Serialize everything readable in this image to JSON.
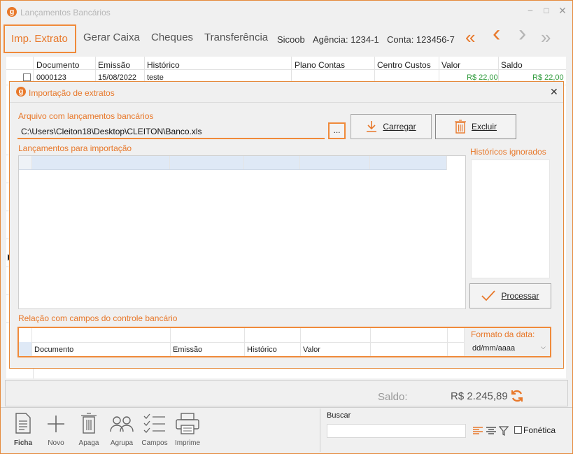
{
  "window": {
    "title": "Lançamentos Bancários",
    "app_icon_glyph": "g"
  },
  "tabs": [
    {
      "label": "Imp. Extrato",
      "active": true
    },
    {
      "label": "Gerar Caixa"
    },
    {
      "label": "Cheques"
    },
    {
      "label": "Transferência"
    }
  ],
  "account": {
    "bank": "Sicoob",
    "agency": "Agência: 1234-1",
    "account": "Conta: 123456-7"
  },
  "nav": {
    "first": "«",
    "prev": "‹",
    "next": "›",
    "last": "»"
  },
  "grid": {
    "columns": [
      "Documento",
      "Emissão",
      "Histórico",
      "Plano Contas",
      "Centro Custos",
      "Valor",
      "Saldo"
    ],
    "rows": [
      {
        "documento": "0000123",
        "emissao": "15/08/2022",
        "historico": "teste",
        "plano": "",
        "centro": "",
        "valor": "R$ 22,00",
        "saldo": "R$ 22,00"
      }
    ]
  },
  "dialog": {
    "title": "Importação de extratos",
    "icon_glyph": "g",
    "file_label": "Arquivo com lançamentos bancários",
    "file_path": "C:\\Users\\Cleiton18\\Desktop\\CLEITON\\Banco.xls",
    "browse_label": "...",
    "load_label": "Carregar",
    "delete_label": "Excluir",
    "entries_label": "Lançamentos para importação",
    "ignored_label": "Históricos ignorados",
    "process_label": "Processar",
    "mapping_label": "Relação com campos do controle bancário",
    "mapping_columns": [
      "Documento",
      "Emissão",
      "Histórico",
      "Valor",
      ""
    ],
    "date_format_label": "Formato da data:",
    "date_format_value": "dd/mm/aaaa"
  },
  "balance": {
    "label": "Saldo:",
    "value": "R$ 2.245,89"
  },
  "toolbar": [
    {
      "label": "Ficha",
      "icon": "document-icon"
    },
    {
      "label": "Novo",
      "icon": "plus-icon"
    },
    {
      "label": "Apaga",
      "icon": "trash-icon"
    },
    {
      "label": "Agrupa",
      "icon": "group-icon"
    },
    {
      "label": "Campos",
      "icon": "checklist-icon"
    },
    {
      "label": "Imprime",
      "icon": "printer-icon"
    }
  ],
  "search": {
    "label": "Buscar",
    "value": "",
    "phonetic_label": "Fonética"
  },
  "colors": {
    "accent": "#e8782a",
    "green": "#2d9a3a",
    "border": "#f08a3a"
  }
}
